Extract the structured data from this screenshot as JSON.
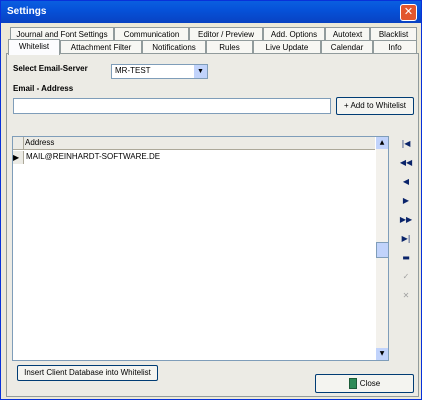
{
  "window": {
    "title": "Settings",
    "close_glyph": "✕"
  },
  "tabs_row1": [
    {
      "label": "Journal and Font Settings"
    },
    {
      "label": "Communication"
    },
    {
      "label": "Editor / Preview"
    },
    {
      "label": "Add. Options"
    },
    {
      "label": "Autotext"
    },
    {
      "label": "Blacklist"
    }
  ],
  "tabs_row2": [
    {
      "label": "Whitelist",
      "active": true
    },
    {
      "label": "Attachment Filter"
    },
    {
      "label": "Notifications"
    },
    {
      "label": "Rules"
    },
    {
      "label": "Live Update"
    },
    {
      "label": "Calendar"
    },
    {
      "label": "Info"
    }
  ],
  "form": {
    "server_label": "Select Email-Server",
    "server_value": "MR-TEST",
    "email_label": "Email - Address",
    "email_value": "",
    "add_button": "+ Add to Whitelist"
  },
  "grid": {
    "column": "Address",
    "rows": [
      {
        "address": "MAIL@REINHARDT-SOFTWARE.DE",
        "current": true
      }
    ]
  },
  "navigator": [
    {
      "name": "first-record",
      "icon": "first-icon",
      "glyph": "|◀"
    },
    {
      "name": "prior-page",
      "icon": "rewind-icon",
      "glyph": "◀◀"
    },
    {
      "name": "prior-record",
      "icon": "prior-icon",
      "glyph": "◀"
    },
    {
      "name": "next-record",
      "icon": "next-icon",
      "glyph": "▶"
    },
    {
      "name": "next-page",
      "icon": "fast-forward-icon",
      "glyph": "▶▶"
    },
    {
      "name": "last-record",
      "icon": "last-icon",
      "glyph": "▶|"
    },
    {
      "name": "delete-record",
      "icon": "minus-icon",
      "glyph": "▬"
    },
    {
      "name": "post-record",
      "icon": "check-icon",
      "glyph": "✓",
      "disabled": true
    },
    {
      "name": "cancel-record",
      "icon": "x-icon",
      "glyph": "✕",
      "disabled": true
    }
  ],
  "buttons": {
    "insert": "Insert Client Database into Whitelist",
    "close": "Close"
  }
}
